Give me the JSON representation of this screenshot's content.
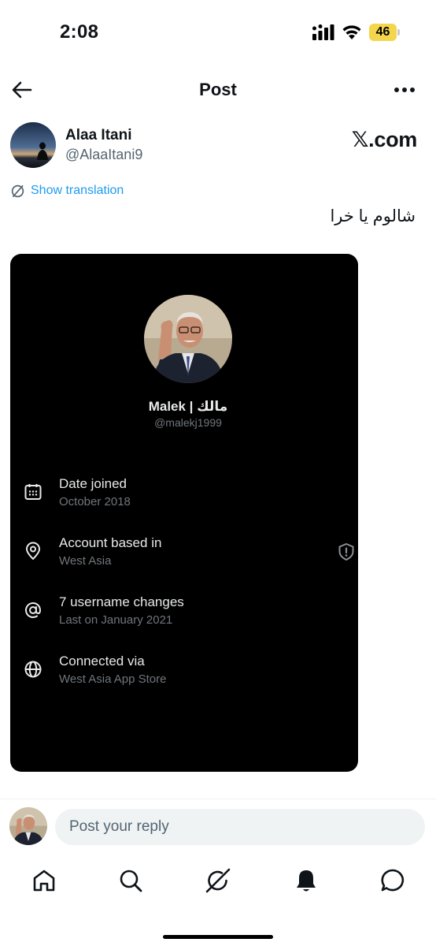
{
  "status_bar": {
    "time": "2:08",
    "battery": "46"
  },
  "header": {
    "title": "Post",
    "back_icon": "arrow-left-icon",
    "more_icon": "more-dots-icon"
  },
  "post": {
    "author_name": "Alaa Itani",
    "author_handle": "@AlaaItani9",
    "source_label": "𝕏.com",
    "translation_label": "Show translation",
    "text": "شالوم يا خرا"
  },
  "card": {
    "profile_name": "Malek | مالك",
    "profile_handle": "@malekj1999",
    "rows": [
      {
        "icon": "calendar-icon",
        "label": "Date joined",
        "sub": "October 2018"
      },
      {
        "icon": "location-pin-icon",
        "label": "Account based in",
        "sub": "West Asia"
      },
      {
        "icon": "at-sign-icon",
        "label": "7 username changes",
        "sub": "Last on January 2021"
      },
      {
        "icon": "globe-icon",
        "label": "Connected via",
        "sub": "West Asia App Store"
      }
    ]
  },
  "reply": {
    "placeholder": "Post your reply"
  },
  "tabs": [
    "home-icon",
    "search-icon",
    "grok-icon",
    "notifications-bell-icon",
    "messages-icon"
  ],
  "colors": {
    "link": "#1d9bf0",
    "muted": "#536471",
    "card_bg": "#000000",
    "battery": "#f4d64d"
  }
}
